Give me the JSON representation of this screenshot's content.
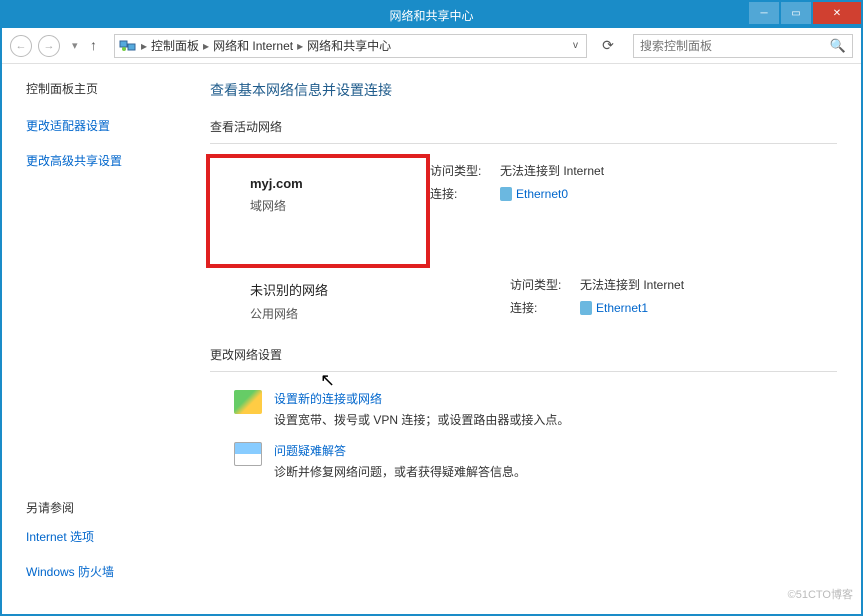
{
  "window": {
    "title": "网络和共享中心"
  },
  "breadcrumb": {
    "item1": "控制面板",
    "item2": "网络和 Internet",
    "item3": "网络和共享中心"
  },
  "search": {
    "placeholder": "搜索控制面板"
  },
  "sidebar": {
    "home": "控制面板主页",
    "link1": "更改适配器设置",
    "link2": "更改高级共享设置",
    "seeAlso": "另请参阅",
    "bottom1": "Internet 选项",
    "bottom2": "Windows 防火墙"
  },
  "main": {
    "heading": "查看基本网络信息并设置连接",
    "activeLabel": "查看活动网络",
    "changeLabel": "更改网络设置"
  },
  "networks": [
    {
      "name": "myj.com",
      "type": "域网络",
      "accessTypeLabel": "访问类型:",
      "accessType": "无法连接到 Internet",
      "connectionLabel": "连接:",
      "connection": "Ethernet0"
    },
    {
      "name": "未识别的网络",
      "type": "公用网络",
      "accessTypeLabel": "访问类型:",
      "accessType": "无法连接到 Internet",
      "connectionLabel": "连接:",
      "connection": "Ethernet1"
    }
  ],
  "actions": {
    "newConn": "设置新的连接或网络",
    "newConnDesc": "设置宽带、拨号或 VPN 连接；或设置路由器或接入点。",
    "trouble": "问题疑难解答",
    "troubleDesc": "诊断并修复网络问题，或者获得疑难解答信息。"
  },
  "watermark": "©51CTO博客"
}
